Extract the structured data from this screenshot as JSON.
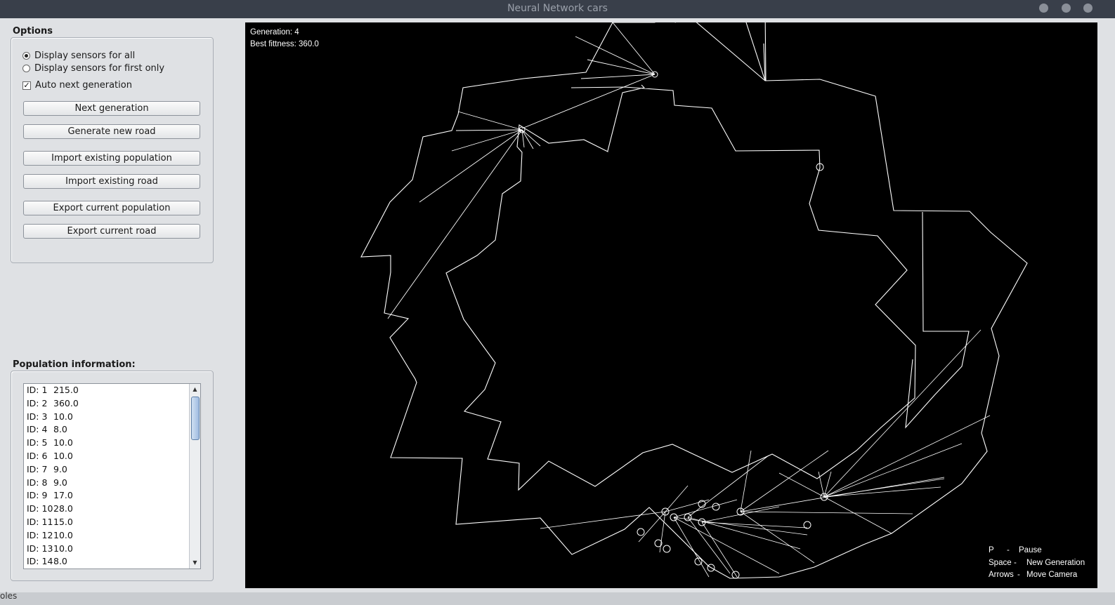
{
  "window": {
    "title": "Neural Network cars"
  },
  "options": {
    "heading": "Options",
    "radio_all": "Display sensors for all",
    "radio_first": "Display sensors for first only",
    "auto_next": "Auto next generation",
    "buttons": {
      "next_generation": "Next generation",
      "generate_road": "Generate new road",
      "import_population": "Import existing population",
      "import_road": "Import existing road",
      "export_population": "Export current population",
      "export_road": "Export current road"
    }
  },
  "population": {
    "heading": "Population information:",
    "rows": [
      {
        "id": "ID: 1",
        "fitness": "215.0"
      },
      {
        "id": "ID: 2",
        "fitness": "360.0"
      },
      {
        "id": "ID: 3",
        "fitness": "10.0"
      },
      {
        "id": "ID: 4",
        "fitness": "8.0"
      },
      {
        "id": "ID: 5",
        "fitness": "10.0"
      },
      {
        "id": "ID: 6",
        "fitness": "10.0"
      },
      {
        "id": "ID: 7",
        "fitness": "9.0"
      },
      {
        "id": "ID: 8",
        "fitness": "9.0"
      },
      {
        "id": "ID: 9",
        "fitness": "17.0"
      },
      {
        "id": "ID: 10",
        "fitness": "28.0"
      },
      {
        "id": "ID: 11",
        "fitness": "15.0"
      },
      {
        "id": "ID: 12",
        "fitness": "10.0"
      },
      {
        "id": "ID: 13",
        "fitness": "10.0"
      },
      {
        "id": "ID: 14",
        "fitness": "8.0"
      }
    ]
  },
  "hud": {
    "generation": "Generation: 4",
    "best_fitness": "Best fittness: 360.0",
    "help": [
      {
        "key": "P",
        "sep": "-",
        "action": "Pause"
      },
      {
        "key": "Space",
        "sep": "-",
        "action": "New Generation"
      },
      {
        "key": "Arrows",
        "sep": "-",
        "action": "Move Camera"
      }
    ]
  },
  "bottom": {
    "text": "oles"
  },
  "colors": {
    "titlebar": "#393f4a",
    "panel": "#dfe1e4",
    "canvas": "#000000",
    "lines": "#ffffff"
  }
}
